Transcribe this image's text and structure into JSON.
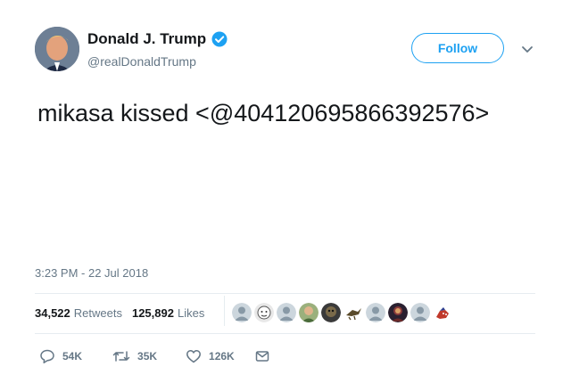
{
  "header": {
    "display_name": "Donald J. Trump",
    "handle": "@realDonaldTrump",
    "follow_label": "Follow"
  },
  "tweet": {
    "text": "mikasa kissed <@404120695866392576>",
    "timestamp": "3:23 PM - 22 Jul 2018"
  },
  "stats": {
    "retweets_count": "34,522",
    "retweets_label": "Retweets",
    "likes_count": "125,892",
    "likes_label": "Likes"
  },
  "actions": {
    "reply_count": "54K",
    "retweet_count": "35K",
    "like_count": "126K"
  },
  "colors": {
    "accent": "#1da1f2",
    "muted": "#657786",
    "divider": "#e6ecf0",
    "text": "#14171a"
  },
  "icons": [
    "verified-badge-icon",
    "chevron-down-icon",
    "reply-icon",
    "retweet-icon",
    "heart-icon",
    "message-icon"
  ]
}
